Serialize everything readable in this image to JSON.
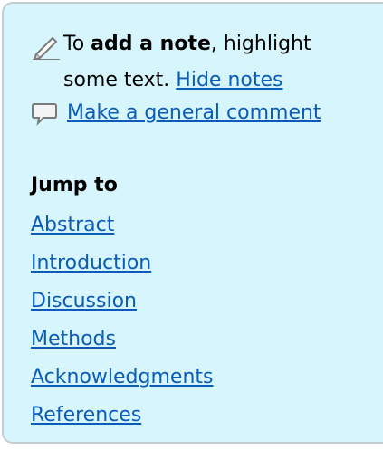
{
  "notes": {
    "text_before": "To ",
    "bold_text": "add a note",
    "text_after": ", highlight",
    "line2_text": "some text. ",
    "hide_link": "Hide notes",
    "pencil_icon": "pencil-icon"
  },
  "comment": {
    "icon": "speech-bubble-icon",
    "link": "Make a general comment"
  },
  "jump": {
    "heading": "Jump to",
    "items": [
      "Abstract",
      "Introduction",
      "Discussion",
      "Methods",
      "Acknowledgments",
      "References"
    ]
  },
  "colors": {
    "panel_bg": "#d6f5fc",
    "panel_border": "#c4ced2",
    "link": "#0a5cb8"
  }
}
